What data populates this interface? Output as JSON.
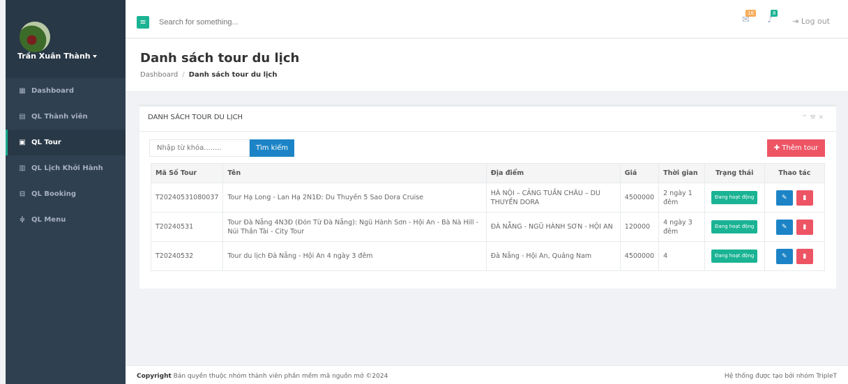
{
  "user": {
    "name": "Trần Xuân Thành"
  },
  "sidebar": {
    "items": [
      {
        "label": "Dashboard",
        "icon": "th-large-icon"
      },
      {
        "label": "QL Thành viên",
        "icon": "id-card-icon"
      },
      {
        "label": "QL Tour",
        "icon": "newspaper-icon"
      },
      {
        "label": "QL Lịch Khởi Hành",
        "icon": "calendar-icon"
      },
      {
        "label": "QL Booking",
        "icon": "hdd-icon"
      },
      {
        "label": "QL Menu",
        "icon": "sliders-icon"
      }
    ]
  },
  "topbar": {
    "search_placeholder": "Search for something...",
    "mail_count": "16",
    "bell_count": "8",
    "logout": "Log out"
  },
  "page": {
    "title": "Danh sách tour du lịch",
    "breadcrumb": [
      "Dashboard",
      "Danh sách tour du lịch"
    ]
  },
  "panel": {
    "title": "DANH SÁCH TOUR DU LỊCH",
    "keyword_placeholder": "Nhập từ khóa........",
    "search_button": "Tìm kiếm",
    "add_button": "Thêm tour"
  },
  "table": {
    "headers": [
      "Mã Số Tour",
      "Tên",
      "Địa điểm",
      "Giá",
      "Thời gian",
      "Trạng thái",
      "Thao tác"
    ],
    "rows": [
      {
        "code": "T20240531080037",
        "name": "Tour Hạ Long - Lan Hạ 2N1Đ: Du Thuyền 5 Sao Dora Cruise",
        "place": "HÀ NỘI – CẢNG TUẦN CHÂU – DU THUYỀN DORA",
        "price": "4500000",
        "duration": "2 ngày 1 đêm",
        "status": "Đang hoạt động"
      },
      {
        "code": "T20240531",
        "name": "Tour Đà Nẵng 4N3Đ (Đón Từ Đà Nẵng): Ngũ Hành Sơn - Hội An - Bà Nà Hill - Núi Thần Tài - City Tour",
        "place": "ĐÀ NẴNG - NGŨ HÀNH SƠN - HỘI AN",
        "price": "120000",
        "duration": "4 ngày 3 đêm",
        "status": "Đang hoạt động"
      },
      {
        "code": "T20240532",
        "name": "Tour du lịch Đà Nẵng - Hội An 4 ngày 3 đêm",
        "place": "Đà Nẵng - Hội An, Quảng Nam",
        "price": "4500000",
        "duration": "4",
        "status": "Đang hoạt động"
      }
    ]
  },
  "footer": {
    "copyright_bold": "Copyright",
    "copyright_text": "Bản quyền thuộc nhóm thành viên phần mềm mã nguồn mở ©2024",
    "made_by": "Hệ thống được tạo bởi nhóm TripleT"
  },
  "colors": {
    "sidebar": "#2f4050",
    "primary": "#1ab394",
    "blue": "#1c84c6",
    "red": "#ed5565",
    "warning": "#f8ac59"
  }
}
